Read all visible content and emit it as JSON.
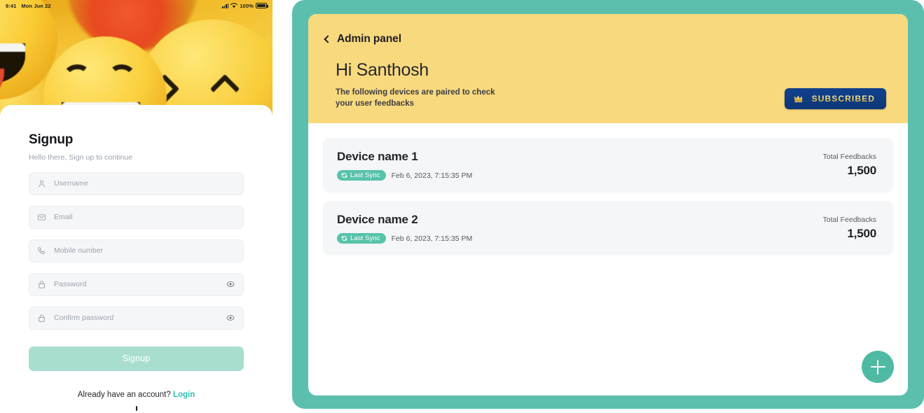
{
  "theme": {
    "teal": "#5cbfad",
    "teal_accent": "#4ebaa4",
    "yellow_header": "#f9d97e",
    "navy_badge": "#11418c",
    "gold_text": "#f6d56a",
    "link_teal": "#2bbfb0",
    "signup_button_bg": "#a8ded0",
    "card_bg": "#f5f6f7"
  },
  "phone": {
    "status_bar": {
      "time": "9:41",
      "date": "Mon Jun 22",
      "battery_percent": "100%",
      "signal_icon": "signal-bars-icon",
      "wifi_icon": "wifi-icon",
      "battery_icon": "battery-icon"
    },
    "hero_image_alt": "laughing emoji faces",
    "signup": {
      "title": "Signup",
      "subtitle": "Hello there, Sign up to continue",
      "fields": [
        {
          "name": "username",
          "placeholder": "Username",
          "value": "",
          "icon": "person-icon",
          "trailing_icon": ""
        },
        {
          "name": "email",
          "placeholder": "Email",
          "value": "",
          "icon": "mail-icon",
          "trailing_icon": ""
        },
        {
          "name": "mobile",
          "placeholder": "Mobile number",
          "value": "",
          "icon": "phone-icon",
          "trailing_icon": ""
        },
        {
          "name": "password",
          "placeholder": "Password",
          "value": "",
          "icon": "lock-icon",
          "trailing_icon": "eye-icon"
        },
        {
          "name": "confirm-password",
          "placeholder": "Confirm password",
          "value": "",
          "icon": "lock-icon",
          "trailing_icon": "eye-icon"
        }
      ],
      "submit_label": "Signup",
      "footer_text": "Already have an account?",
      "footer_link": "Login"
    }
  },
  "admin": {
    "back_label": "Admin panel",
    "back_icon": "chevron-left-icon",
    "greeting": "Hi Santhosh",
    "greeting_sub": "The following devices are paired to check your user feedbacks",
    "subscription_badge": {
      "label": "SUBSCRIBED",
      "icon": "crown-icon"
    },
    "devices": [
      {
        "name": "Device name 1",
        "sync_label": "Last Sync",
        "sync_icon": "sync-icon",
        "sync_date": "Feb 6, 2023, 7:15:35 PM",
        "feedback_label": "Total Feedbacks",
        "feedback_count": "1,500"
      },
      {
        "name": "Device name 2",
        "sync_label": "Last Sync",
        "sync_icon": "sync-icon",
        "sync_date": "Feb 6, 2023, 7:15:35 PM",
        "feedback_label": "Total Feedbacks",
        "feedback_count": "1,500"
      }
    ],
    "add_button": {
      "icon": "plus-icon",
      "label": ""
    }
  }
}
